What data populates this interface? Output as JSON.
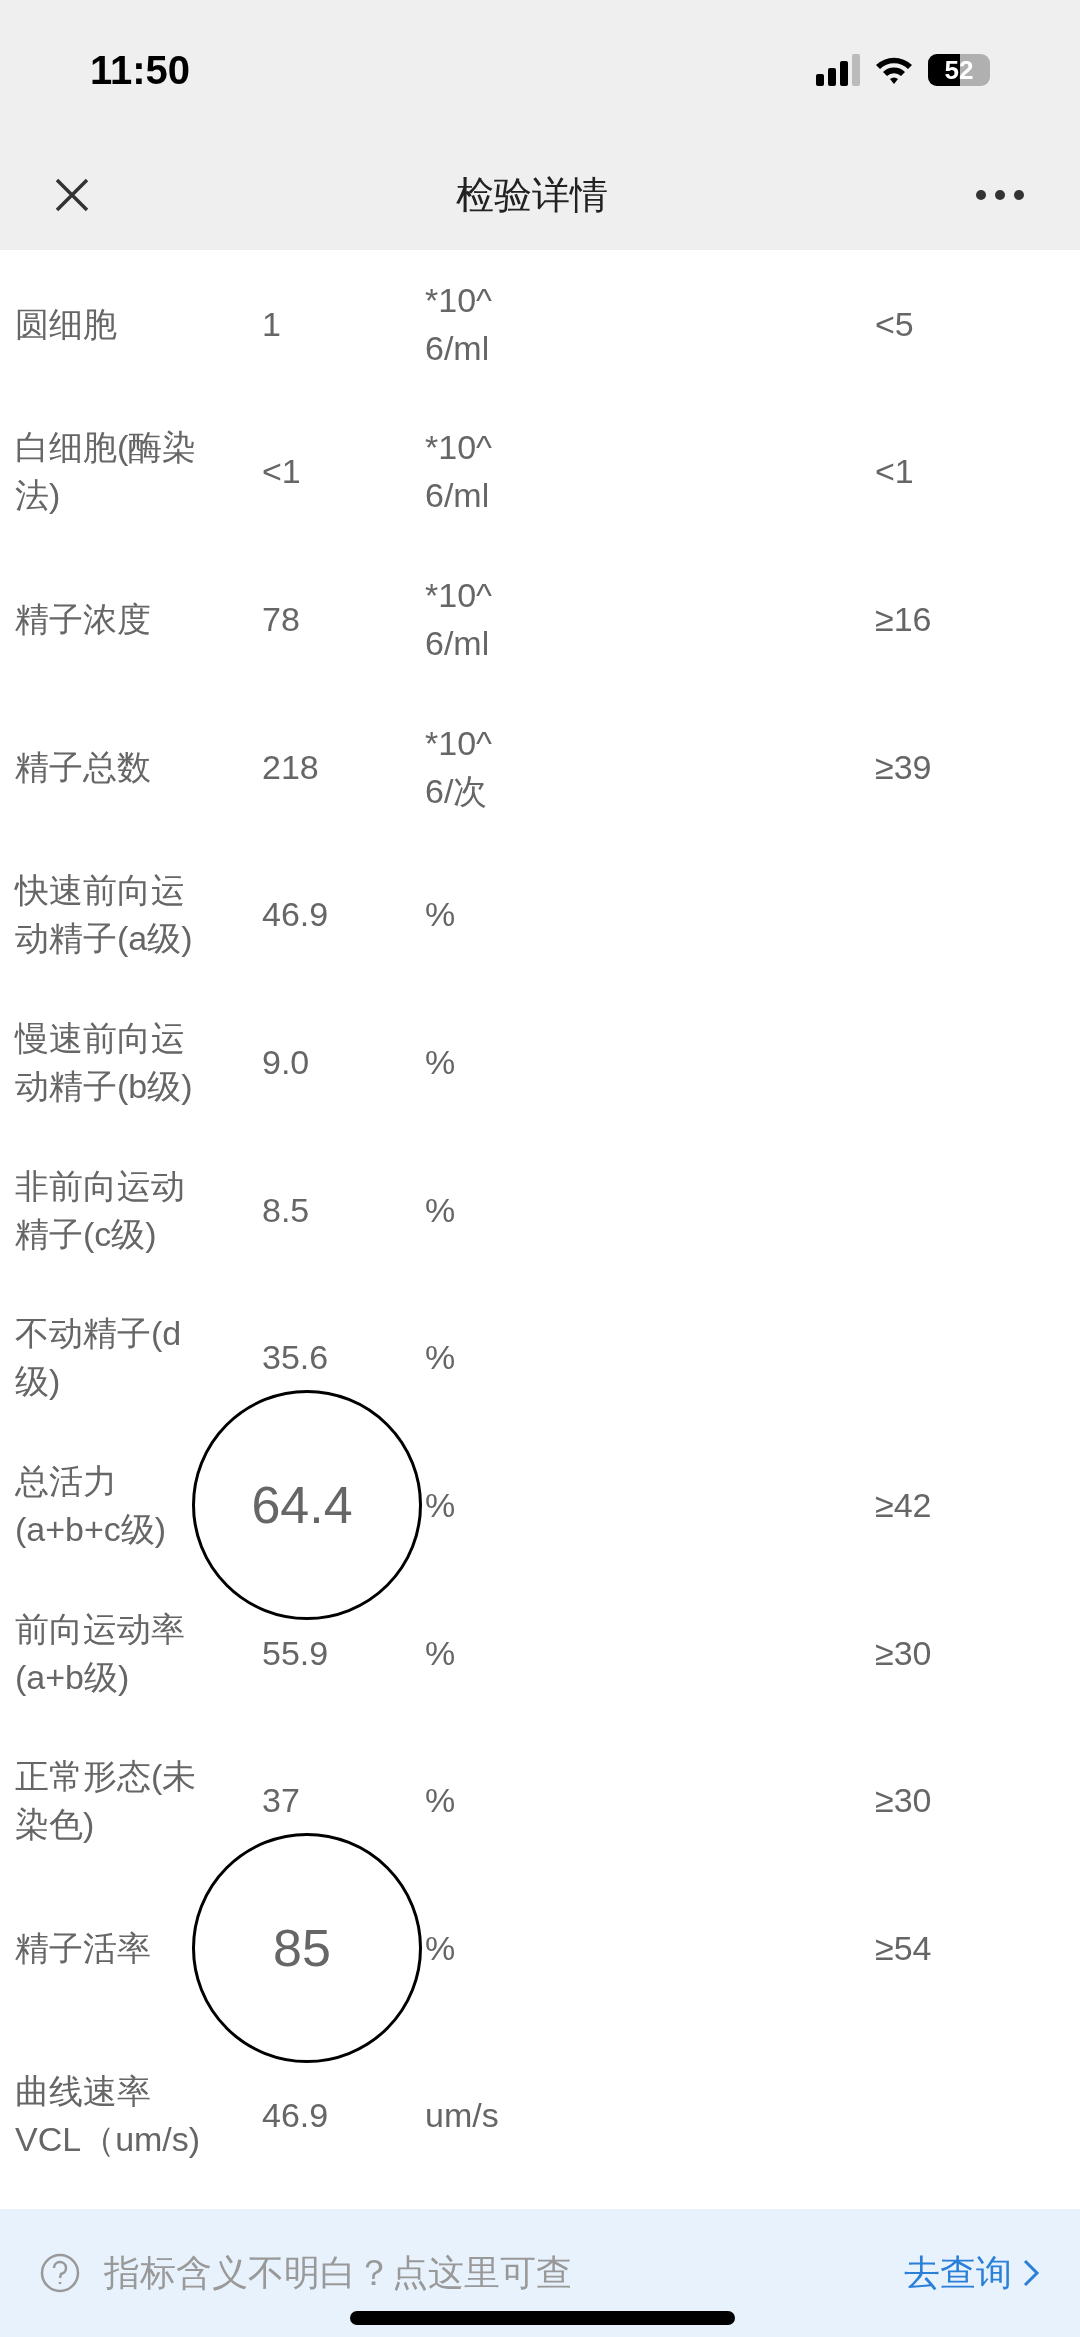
{
  "status_bar": {
    "time": "11:50",
    "battery": "52"
  },
  "nav": {
    "title": "检验详情"
  },
  "rows": [
    {
      "name": "圆细胞",
      "value": "1",
      "unit": "*10^6/ml",
      "reference": "<5",
      "magnified": false
    },
    {
      "name": "白细胞(酶染法)",
      "value": "<1",
      "unit": "*10^6/ml",
      "reference": "<1",
      "magnified": false
    },
    {
      "name": "精子浓度",
      "value": "78",
      "unit": "*10^6/ml",
      "reference": "≥16",
      "magnified": false
    },
    {
      "name": "精子总数",
      "value": "218",
      "unit": "*10^6/次",
      "reference": "≥39",
      "magnified": false
    },
    {
      "name": "快速前向运动精子(a级)",
      "value": "46.9",
      "unit": "%",
      "magnified": false
    },
    {
      "name": "慢速前向运动精子(b级)",
      "value": "9.0",
      "unit": "%",
      "magnified": false
    },
    {
      "name": "非前向运动精子(c级)",
      "value": "8.5",
      "unit": "%",
      "magnified": false
    },
    {
      "name": "不动精子(d级)",
      "value": "35.6",
      "unit": "%",
      "magnified": false
    },
    {
      "name": "总活力(a+b+c级)",
      "value": "64.4",
      "unit": "%",
      "reference": "≥42",
      "magnified": true
    },
    {
      "name": "前向运动率(a+b级)",
      "value": "55.9",
      "unit": "%",
      "reference": "≥30",
      "magnified": false
    },
    {
      "name": "正常形态(未染色)",
      "value": "37",
      "unit": "%",
      "reference": "≥30",
      "magnified": false
    },
    {
      "name": "精子活率",
      "value": "85",
      "unit": "%",
      "reference": "≥54",
      "magnified": true
    },
    {
      "name": "曲线速率VCL（um/s)",
      "value": "46.9",
      "unit": "um/s",
      "magnified": false
    }
  ],
  "help_bar": {
    "text": "指标含义不明白？点这里可查",
    "link": "去查询"
  }
}
